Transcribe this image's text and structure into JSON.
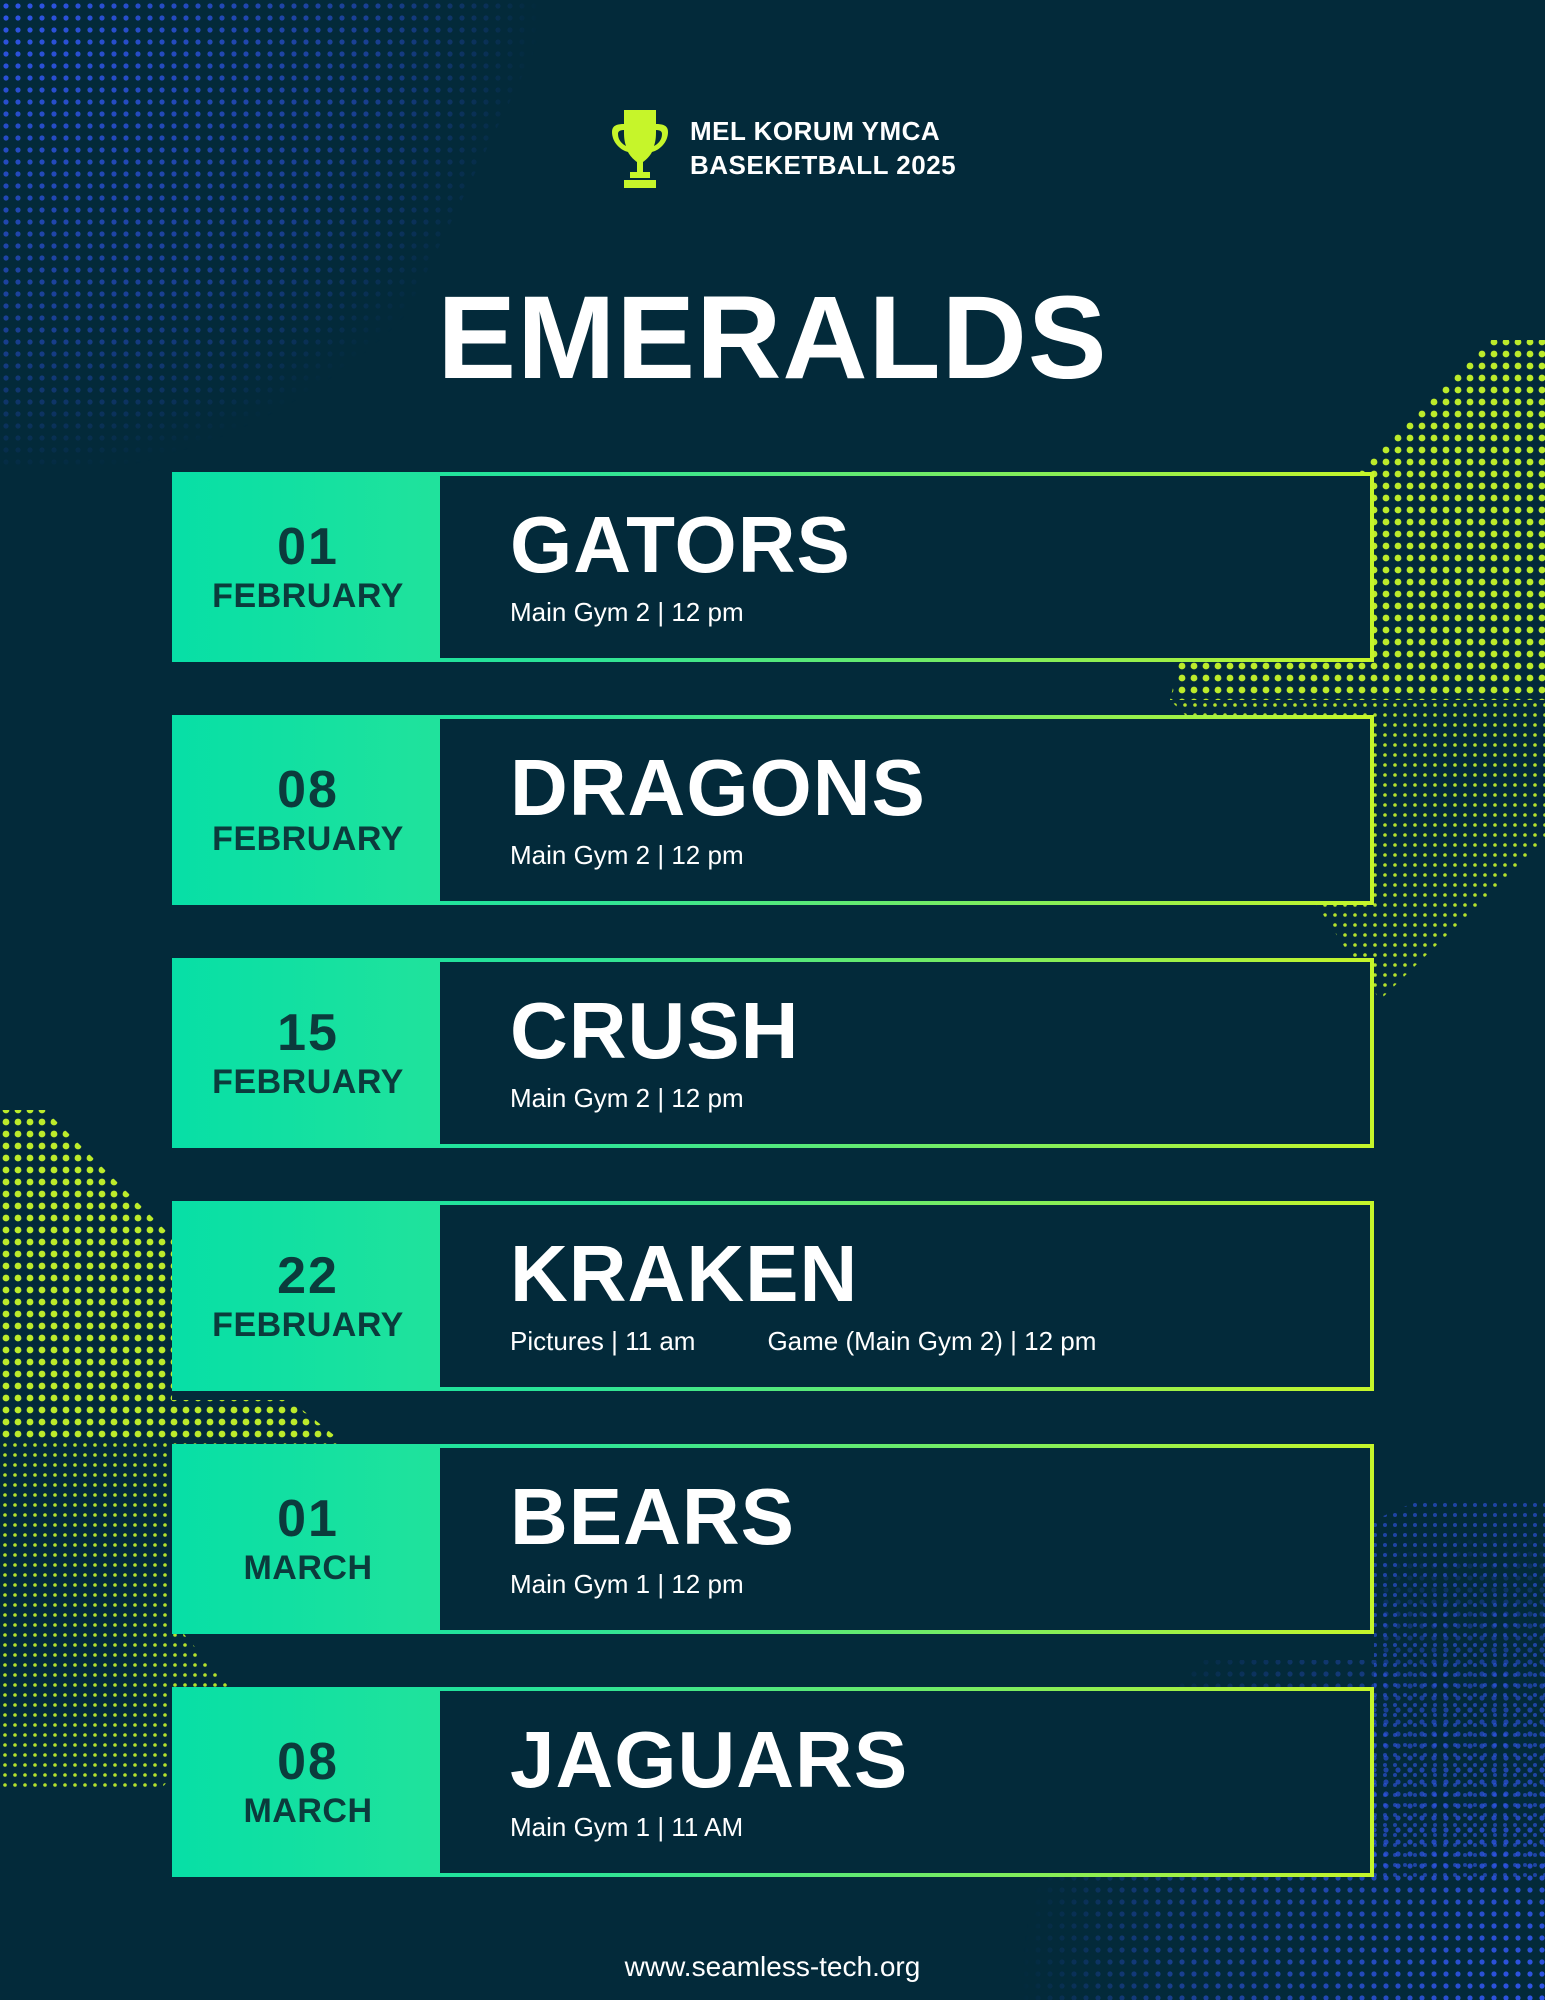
{
  "header": {
    "org_line1": "MEL KORUM YMCA",
    "org_line2": "BASEKETBALL 2025"
  },
  "team": {
    "name": "EMERALDS"
  },
  "games": [
    {
      "day": "01",
      "month": "FEBRUARY",
      "opponent": "GATORS",
      "details": [
        "Main Gym 2 | 12 pm"
      ]
    },
    {
      "day": "08",
      "month": "FEBRUARY",
      "opponent": "DRAGONS",
      "details": [
        "Main Gym 2 | 12 pm"
      ]
    },
    {
      "day": "15",
      "month": "FEBRUARY",
      "opponent": "CRUSH",
      "details": [
        "Main Gym 2 | 12 pm"
      ]
    },
    {
      "day": "22",
      "month": "FEBRUARY",
      "opponent": "KRAKEN",
      "details": [
        "Pictures | 11 am",
        "Game (Main Gym 2) | 12 pm"
      ]
    },
    {
      "day": "01",
      "month": "MARCH",
      "opponent": "BEARS",
      "details": [
        "Main Gym 1 | 12 pm"
      ]
    },
    {
      "day": "08",
      "month": "MARCH",
      "opponent": "JAGUARS",
      "details": [
        "Main Gym 1 | 11 AM"
      ]
    }
  ],
  "footer": {
    "website": "www.seamless-tech.org"
  },
  "colors": {
    "background": "#032a3a",
    "gradient_start": "#07dfa6",
    "gradient_end": "#c6f52a",
    "lime": "#c6f52a",
    "blue": "#2f55e8",
    "date_text": "#0b3b3c"
  },
  "icons": {
    "trophy": "trophy-icon"
  }
}
